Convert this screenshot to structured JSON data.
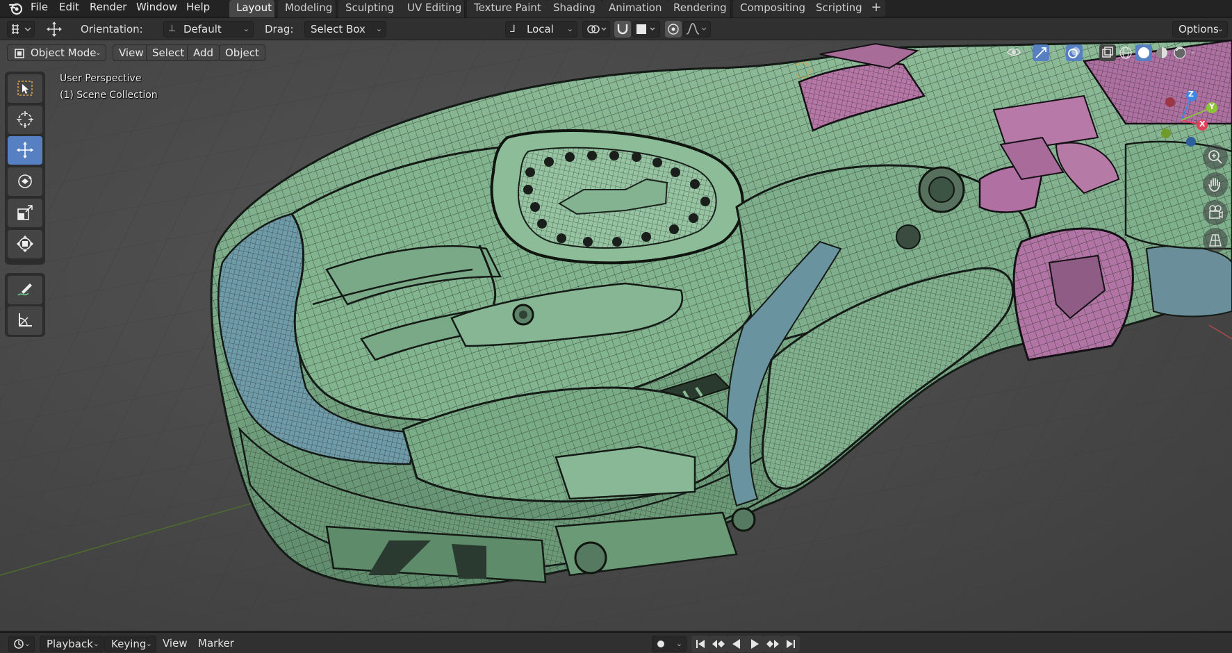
{
  "app": {
    "name": "Blender"
  },
  "menubar": {
    "menus": [
      "File",
      "Edit",
      "Render",
      "Window",
      "Help"
    ],
    "workspace_tabs": [
      "Layout",
      "Modeling",
      "Sculpting",
      "UV Editing",
      "Texture Paint",
      "Shading",
      "Animation",
      "Rendering",
      "Compositing",
      "Scripting"
    ],
    "active_tab": "Layout",
    "add_tab_label": "+"
  },
  "tool_header": {
    "orientation_label": "Orientation:",
    "orientation_value": "Default",
    "drag_label": "Drag:",
    "drag_value": "Select Box",
    "pivot_value": "Local",
    "options_label": "Options"
  },
  "viewport_header": {
    "mode": "Object Mode",
    "menus": [
      "View",
      "Select",
      "Add",
      "Object"
    ]
  },
  "viewport": {
    "perspective": "User Perspective",
    "collection": "(1) Scene Collection"
  },
  "tools": [
    {
      "name": "select-box",
      "icon": "select-box-icon",
      "active": false
    },
    {
      "name": "cursor",
      "icon": "cursor-icon",
      "active": false
    },
    {
      "name": "move",
      "icon": "move-icon",
      "active": true
    },
    {
      "name": "rotate",
      "icon": "rotate-icon",
      "active": false
    },
    {
      "name": "scale",
      "icon": "scale-icon",
      "active": false
    },
    {
      "name": "transform",
      "icon": "transform-icon",
      "active": false
    },
    {
      "name": "annotate",
      "icon": "annotate-icon",
      "active": false
    },
    {
      "name": "measure",
      "icon": "measure-icon",
      "active": false
    }
  ],
  "gizmo": {
    "x_label": "X",
    "y_label": "Y",
    "z_label": "Z"
  },
  "timeline_header": {
    "menus": [
      "Playback",
      "Keying",
      "View",
      "Marker"
    ]
  },
  "colors": {
    "accent": "#5680c2",
    "mesh_green": "#7fae8c",
    "mesh_blue": "#6e98a6",
    "mesh_pink": "#b678a8",
    "axis_x": "#e0405a",
    "axis_y": "#8cc43a",
    "axis_z": "#3f86e0"
  }
}
